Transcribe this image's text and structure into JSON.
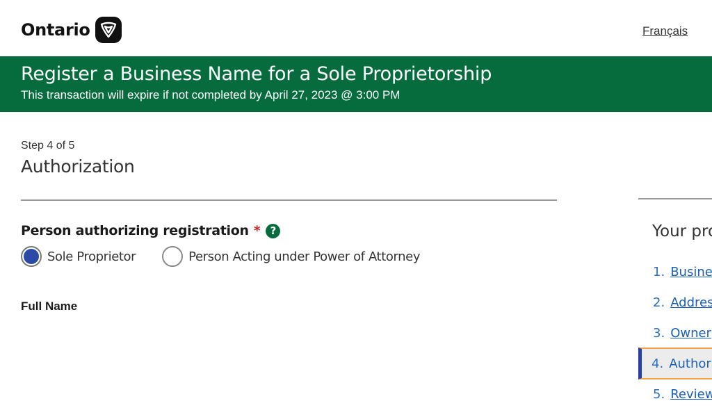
{
  "header": {
    "logo_text": "Ontario",
    "logo_icon": "trillium-icon",
    "language_link": "Français"
  },
  "banner": {
    "title": "Register a Business Name for a Sole Proprietorship",
    "subtitle": "This transaction will expire if not completed by April 27, 2023 @ 3:00 PM",
    "background_color": "#066c3d"
  },
  "step": {
    "label": "Step 4 of 5",
    "title": "Authorization"
  },
  "form": {
    "authorizer": {
      "label": "Person authorizing registration",
      "required_marker": "*",
      "help_icon": "question-circle-icon",
      "help_glyph": "?",
      "options": [
        {
          "label": "Sole Proprietor",
          "checked": true
        },
        {
          "label": "Person Acting under Power of Attorney",
          "checked": false
        }
      ]
    },
    "full_name_label": "Full Name"
  },
  "sidebar": {
    "title": "Your progress",
    "items": [
      {
        "num": "1.",
        "label": "Business",
        "link": true,
        "current": false
      },
      {
        "num": "2.",
        "label": "Address",
        "link": true,
        "current": false
      },
      {
        "num": "3.",
        "label": "Owner",
        "link": true,
        "current": false
      },
      {
        "num": "4.",
        "label": "Authorization",
        "link": false,
        "current": true
      },
      {
        "num": "5.",
        "label": "Review",
        "link": true,
        "current": false
      }
    ]
  }
}
